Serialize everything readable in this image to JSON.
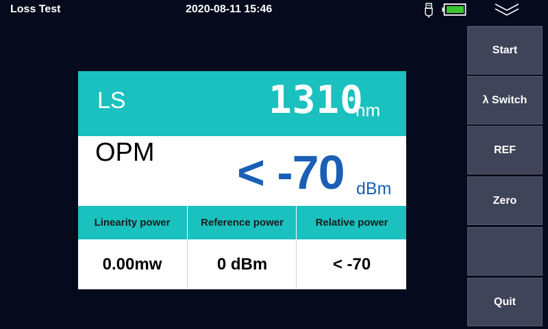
{
  "header": {
    "title": "Loss Test",
    "datetime": "2020-08-11 15:46",
    "battery_color": "#39c62f"
  },
  "sidebar": {
    "buttons": [
      {
        "label": "Start"
      },
      {
        "label": "λ Switch"
      },
      {
        "label": "REF"
      },
      {
        "label": "Zero"
      },
      {
        "label": ""
      },
      {
        "label": "Quit"
      }
    ]
  },
  "light_source": {
    "label": "LS",
    "wavelength": "1310",
    "unit": "nm"
  },
  "power_meter": {
    "label": "OPM",
    "value": "< -70",
    "unit": "dBm"
  },
  "table": {
    "headers": [
      "Linearity power",
      "Reference power",
      "Relative power"
    ],
    "values": [
      "0.00mw",
      "0 dBm",
      "< -70"
    ]
  },
  "colors": {
    "background": "#050b1c",
    "teal": "#1ac1be",
    "button": "#3f4458",
    "value_blue": "#1a5fb5"
  }
}
